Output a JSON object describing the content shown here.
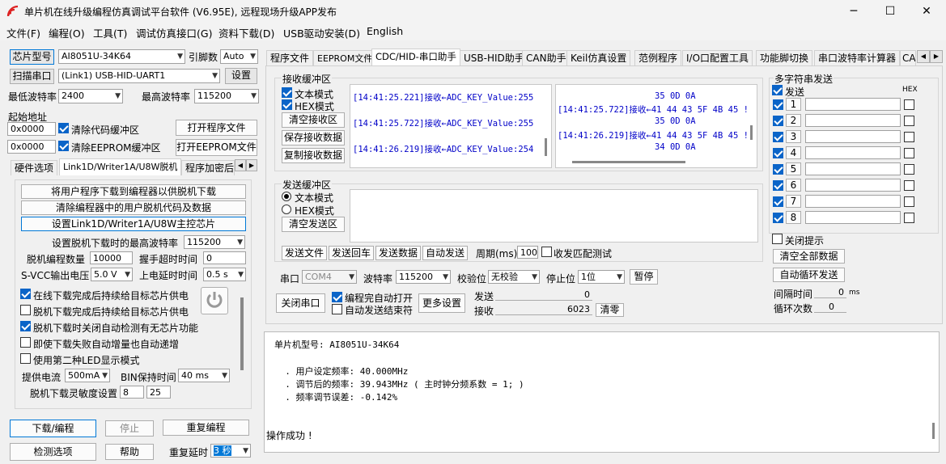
{
  "window": {
    "title": "单片机在线升级编程仿真调试平台软件 (V6.95E), 远程现场升级APP发布",
    "minimize": "─",
    "maximize": "☐",
    "close": "✕"
  },
  "menu": [
    "文件(F)",
    "编程(O)",
    "工具(T)",
    "调试仿真接口(G)",
    "资料下载(D)",
    "USB驱动安装(D)",
    "English"
  ],
  "left": {
    "chip_label": "芯片型号",
    "chip_value": "AI8051U-34K64",
    "pin_label": "引脚数",
    "pin_value": "Auto",
    "scan_button": "扫描串口",
    "port_value": "(Link1) USB-HID-UART1",
    "settings_button": "设置",
    "min_baud_label": "最低波特率",
    "min_baud_value": "2400",
    "max_baud_label": "最高波特率",
    "max_baud_value": "115200",
    "start_addr_label": "起始地址",
    "addr1": "0x0000",
    "clear_code": "清除代码缓冲区",
    "open_prog": "打开程序文件",
    "addr2": "0x0000",
    "clear_eeprom": "清除EEPROM缓冲区",
    "open_eeprom": "打开EEPROM文件",
    "tabs": [
      "硬件选项",
      "Link1D/Writer1A/U8W脱机",
      "程序加密后"
    ],
    "offline_btn1": "将用户程序下载到编程器以供脱机下载",
    "offline_btn2": "清除编程器中的用户脱机代码及数据",
    "offline_btn3": "设置Link1D/Writer1A/U8W主控芯片",
    "offline_max_baud_label": "设置脱机下载时的最高波特率",
    "offline_max_baud_value": "115200",
    "offline_count_label": "脱机编程数量",
    "offline_count_value": "10000",
    "handshake_label": "握手超时时间",
    "handshake_value": "0",
    "svcc_label": "S-VCC输出电压",
    "svcc_value": "5.0 V",
    "power_delay_label": "上电延时时间",
    "power_delay_value": "0.5 s",
    "opt1": "在线下载完成后持续给目标芯片供电",
    "opt2": "脱机下载完成后持续给目标芯片供电",
    "opt3": "脱机下载时关闭自动检测有无芯片功能",
    "opt4": "即使下载失败自动增量也自动递增",
    "opt5": "使用第二种LED显示模式",
    "current_label": "提供电流",
    "current_value": "500mA",
    "bin_hold_label": "BIN保持时间",
    "bin_hold_value": "40 ms",
    "sensitivity_label": "脱机下载灵敏度设置",
    "sens1": "8",
    "sens2": "25",
    "download_button": "下载/编程",
    "stop_button": "停止",
    "reprogram_button": "重复编程",
    "check_button": "检测选项",
    "help_button": "帮助",
    "repeat_delay_label": "重复延时",
    "repeat_delay_value": "3 秒"
  },
  "tabs": [
    "程序文件",
    "EEPROM文件",
    "CDC/HID-串口助手",
    "USB-HID助手",
    "CAN助手",
    "Keil仿真设置",
    "范例程序",
    "I/O口配置工具",
    "功能脚切换",
    "串口波特率计算器",
    "CA"
  ],
  "serial": {
    "recv_title": "接收缓冲区",
    "text_mode": "文本模式",
    "hex_mode": "HEX模式",
    "clear_recv": "清空接收区",
    "save_recv": "保存接收数据",
    "copy_recv": "复制接收数据",
    "recv_text_lines": [
      "[14:41:25.221]接收←ADC_KEY_Value:255",
      "[14:41:25.722]接收←ADC_KEY_Value:255",
      "[14:41:26.219]接收←ADC_KEY_Value:254"
    ],
    "recv_hex_lines": [
      "35 0D 0A",
      "[14:41:25.722]接收←41 44 43 5F 4B 45 !",
      "35 0D 0A",
      "[14:41:26.219]接收←41 44 43 5F 4B 45 !",
      "34 0D 0A"
    ],
    "send_title": "发送缓冲区",
    "send_text_mode": "文本模式",
    "send_hex_mode": "HEX模式",
    "clear_send": "清空发送区",
    "send_file": "发送文件",
    "send_back": "发送回车",
    "send_data": "发送数据",
    "auto_send": "自动发送",
    "period_label": "周期(ms)",
    "period_value": "100",
    "match_test": "收发匹配测试",
    "port_label": "串口",
    "port_value": "COM4",
    "baud_label": "波特率",
    "baud_value": "115200",
    "parity_label": "校验位",
    "parity_value": "无校验",
    "stop_label": "停止位",
    "stop_value": "1位",
    "pause": "暂停",
    "close_port": "关闭串口",
    "auto_open": "编程完自动打开",
    "auto_end": "自动发送结束符",
    "more_settings": "更多设置",
    "send_label": "发送",
    "send_count": "0",
    "recv_label": "接收",
    "recv_count": "6023",
    "clear_count": "清零"
  },
  "multi": {
    "title": "多字符串发送",
    "send_label": "发送",
    "hex_label": "HEX",
    "rows": [
      "1",
      "2",
      "3",
      "4",
      "5",
      "6",
      "7",
      "8"
    ],
    "close_tip": "关闭提示",
    "clear_all": "清空全部数据",
    "auto_loop": "自动循环发送",
    "interval_label": "间隔时间",
    "interval_value": "0",
    "interval_unit": "ms",
    "loop_label": "循环次数",
    "loop_value": "0"
  },
  "log": {
    "lines": [
      "单片机型号: AI8051U-34K64",
      "",
      "  . 用户设定频率: 40.000MHz",
      "  . 调节后的频率: 39.943MHz ( 主时钟分频系数 = 1; )",
      "  . 频率调节误差: -0.142%",
      "",
      "",
      "操作成功 !"
    ]
  }
}
